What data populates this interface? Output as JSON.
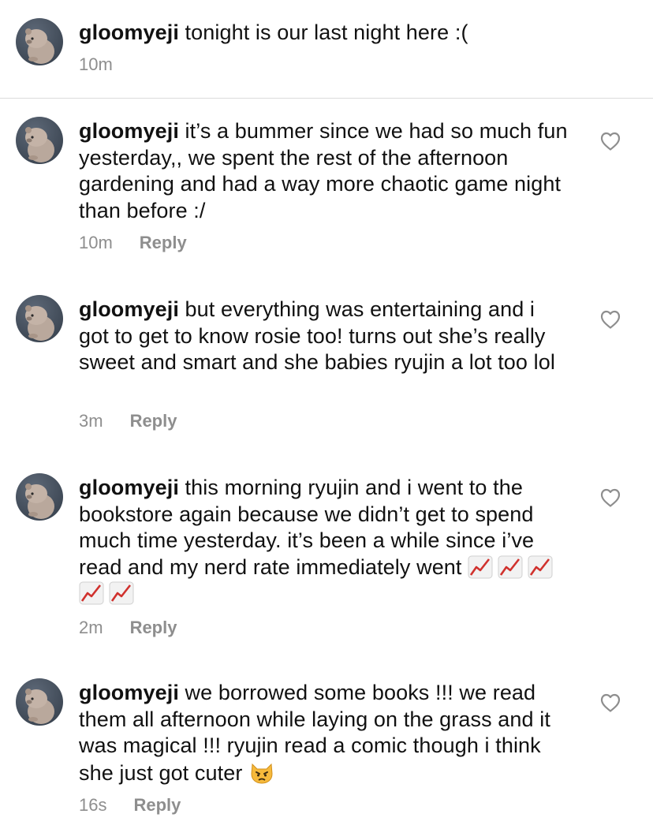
{
  "caption": {
    "username": "gloomyeji",
    "text": "tonight is our last night here :(",
    "time": "10m"
  },
  "comments": [
    {
      "username": "gloomyeji",
      "text": "it’s a bummer since we had so much fun yesterday,, we spent the rest of the afternoon gardening and had a way more chaotic game night than before :/",
      "time": "10m",
      "reply_label": "Reply"
    },
    {
      "username": "gloomyeji",
      "text": "but everything was entertaining and i got to get to know rosie too! turns out she’s really sweet and smart and she babies ryujin a lot too lol",
      "time": "3m",
      "reply_label": "Reply"
    },
    {
      "username": "gloomyeji",
      "text": "this morning ryujin and i went to the bookstore again because we didn’t get to spend much time yesterday. it’s been a while since i’ve read and my nerd rate immediately went",
      "trailing_emoji": [
        "chart-increasing-emoji",
        "chart-increasing-emoji",
        "chart-increasing-emoji",
        "chart-increasing-emoji",
        "chart-increasing-emoji"
      ],
      "time": "2m",
      "reply_label": "Reply"
    },
    {
      "username": "gloomyeji",
      "text": "we borrowed some books !!! we read them all afternoon while laying on the grass and it was magical !!! ryujin read a comic though i think she just got cuter",
      "trailing_emoji": [
        "pouting-cat-emoji"
      ],
      "time": "16s",
      "reply_label": "Reply"
    }
  ],
  "colors": {
    "text": "#111111",
    "meta": "#8e8e8e",
    "divider": "#dbdbdb",
    "chart_emoji_line": "#d0312d"
  },
  "icons": {
    "like": "heart-outline-icon",
    "avatar": "bear-avatar"
  }
}
